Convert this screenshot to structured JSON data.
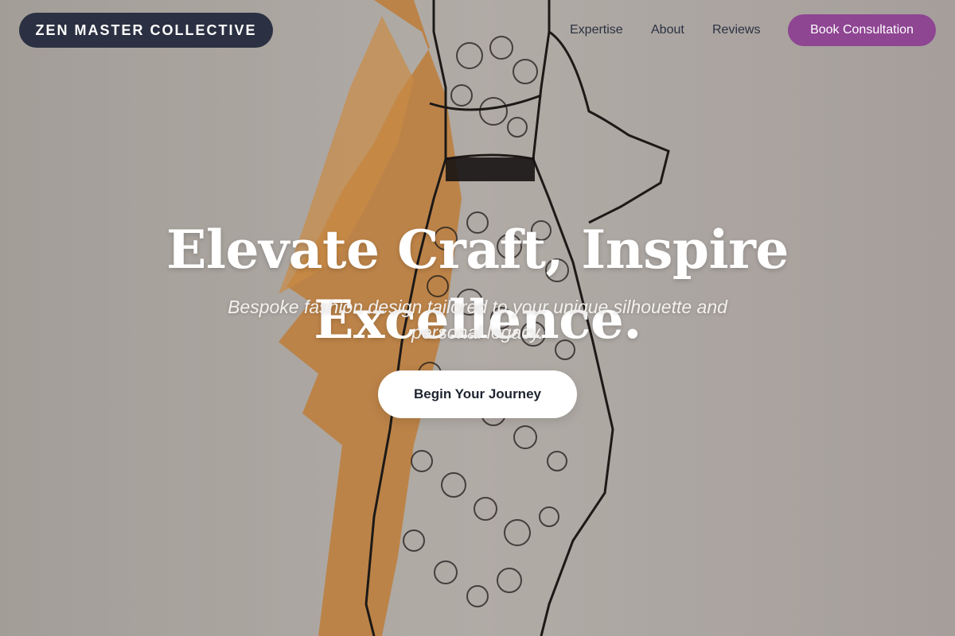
{
  "header": {
    "brand": "ZEN MASTER COLLECTIVE",
    "nav": {
      "expertise": "Expertise",
      "about": "About",
      "reviews": "Reviews"
    },
    "cta_label": "Book Consultation"
  },
  "hero": {
    "headline": "Elevate Craft, Inspire Excellence.",
    "subhead": "Bespoke fashion design tailored to your unique silhouette and personal legacy.",
    "button_label": "Begin Your Journey"
  },
  "colors": {
    "brand_bg": "#2b3142",
    "accent": "#8e4592",
    "paper": "#c9c4be",
    "wash": "#d9913f"
  },
  "background": {
    "icon": "fashion-sketch-illustration"
  }
}
